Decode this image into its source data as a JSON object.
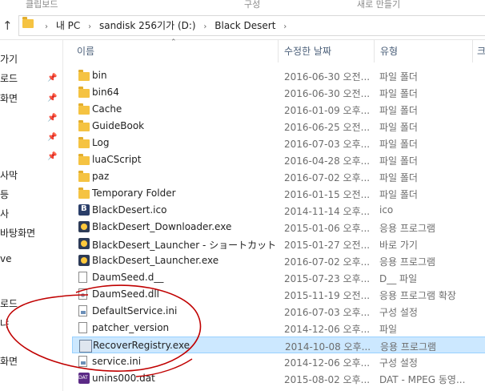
{
  "ribbon": {
    "left": "클립보드",
    "mid": "구성",
    "right": "새로 만들기"
  },
  "address": {
    "crumbs": [
      "내 PC",
      "sandisk 256기가 (D:)",
      "Black Desert"
    ]
  },
  "nav": {
    "items": [
      "가기",
      "로드",
      "화면",
      "사막",
      "등",
      "사",
      "바탕화면",
      "ve",
      "로드",
      "냐",
      "화면"
    ]
  },
  "columns": {
    "name": "이름",
    "date": "수정한 날짜",
    "type": "유형",
    "size": "크"
  },
  "files": [
    {
      "name": "bin",
      "date": "2016-06-30 오전...",
      "type": "파일 폴더",
      "icon": "folder-icon"
    },
    {
      "name": "bin64",
      "date": "2016-06-30 오전...",
      "type": "파일 폴더",
      "icon": "folder-icon"
    },
    {
      "name": "Cache",
      "date": "2016-01-09 오후...",
      "type": "파일 폴더",
      "icon": "folder-icon"
    },
    {
      "name": "GuideBook",
      "date": "2016-06-25 오전...",
      "type": "파일 폴더",
      "icon": "folder-icon"
    },
    {
      "name": "Log",
      "date": "2016-07-03 오후...",
      "type": "파일 폴더",
      "icon": "folder-icon"
    },
    {
      "name": "luaCScript",
      "date": "2016-04-28 오후...",
      "type": "파일 폴더",
      "icon": "folder-icon"
    },
    {
      "name": "paz",
      "date": "2016-07-02 오후...",
      "type": "파일 폴더",
      "icon": "folder-icon"
    },
    {
      "name": "Temporary Folder",
      "date": "2016-01-15 오전...",
      "type": "파일 폴더",
      "icon": "folder-icon"
    },
    {
      "name": "BlackDesert.ico",
      "date": "2014-11-14 오후...",
      "type": "ico",
      "icon": "ico-file-icon"
    },
    {
      "name": "BlackDesert_Downloader.exe",
      "date": "2015-01-06 오후...",
      "type": "응용 프로그램",
      "icon": "exe-icon"
    },
    {
      "name": "BlackDesert_Launcher - ショートカット",
      "date": "2015-01-27 오전...",
      "type": "바로 가기",
      "icon": "exe-icon"
    },
    {
      "name": "BlackDesert_Launcher.exe",
      "date": "2016-07-02 오후...",
      "type": "응용 프로그램",
      "icon": "exe-icon"
    },
    {
      "name": "DaumSeed.d__",
      "date": "2015-07-23 오후...",
      "type": "D__ 파일",
      "icon": "doc-icon"
    },
    {
      "name": "DaumSeed.dll",
      "date": "2015-11-19 오전...",
      "type": "응용 프로그램 확장",
      "icon": "dll-icon"
    },
    {
      "name": "DefaultService.ini",
      "date": "2016-07-03 오후...",
      "type": "구성 설정",
      "icon": "ini-icon"
    },
    {
      "name": "patcher_version",
      "date": "2014-12-06 오후...",
      "type": "파일",
      "icon": "doc-icon"
    },
    {
      "name": "RecoverRegistry.exe",
      "date": "2014-10-08 오후...",
      "type": "응용 프로그램",
      "icon": "reg-icon",
      "selected": true
    },
    {
      "name": "service.ini",
      "date": "2014-12-06 오후...",
      "type": "구성 설정",
      "icon": "ini-icon"
    },
    {
      "name": "unins000.dat",
      "date": "2015-08-02 오후...",
      "type": "DAT - MPEG 동영...",
      "icon": "dat-icon"
    }
  ],
  "colors": {
    "selection": "#cce8ff",
    "annotation": "#c00000",
    "folder": "#f5c342"
  }
}
